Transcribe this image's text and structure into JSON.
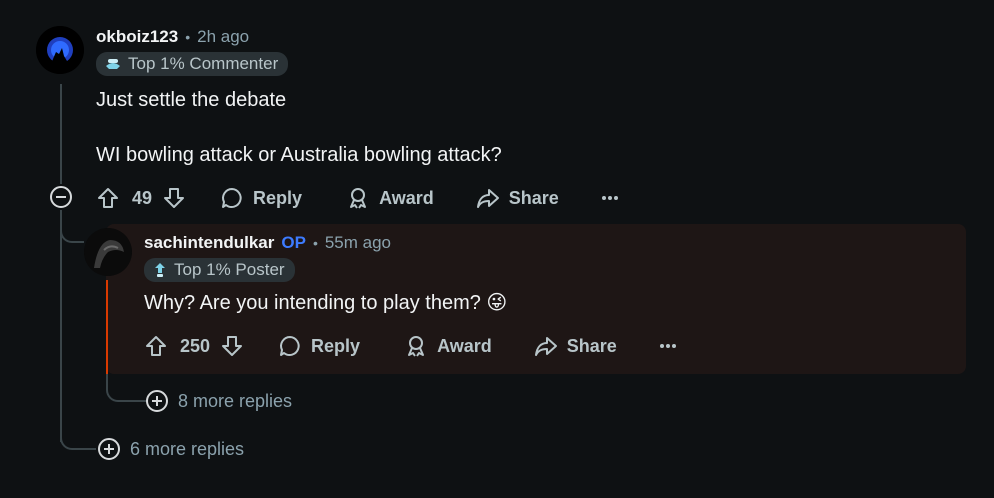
{
  "comment": {
    "username": "okboiz123",
    "separator": "•",
    "time": "2h ago",
    "flair_icon": "commenter-badge-icon",
    "flair": "Top 1% Commenter",
    "body_line1": "Just settle the debate",
    "body_line2": "WI bowling attack or Australia bowling attack?",
    "votes": "49",
    "reply_label": "Reply",
    "award_label": "Award",
    "share_label": "Share",
    "more_replies": "6 more replies"
  },
  "reply": {
    "username": "sachintendulkar",
    "op_badge": "OP",
    "separator": "•",
    "time": "55m ago",
    "flair_icon": "poster-badge-icon",
    "flair": "Top 1% Poster",
    "body": "Why? Are you intending to play them? 😜",
    "votes": "250",
    "reply_label": "Reply",
    "award_label": "Award",
    "share_label": "Share",
    "more_replies": "8 more replies",
    "highlight_color": "#1e1615",
    "accent_color": "#d93a00"
  }
}
